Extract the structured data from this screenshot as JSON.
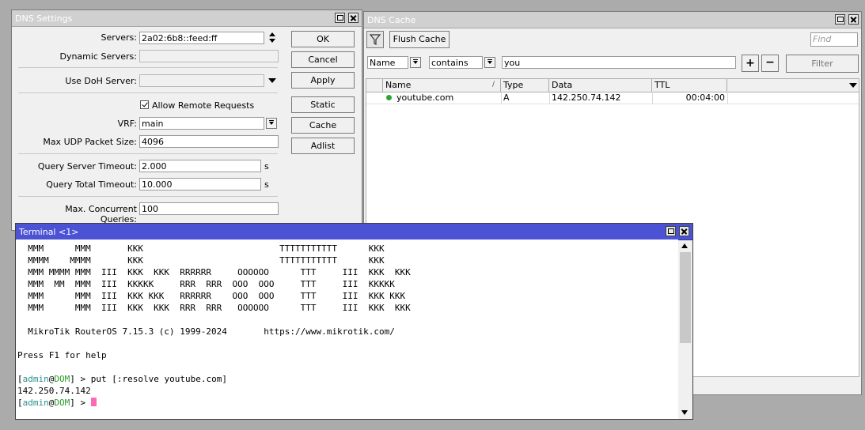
{
  "dns_settings": {
    "title": "DNS Settings",
    "fields": {
      "servers": {
        "label": "Servers:",
        "value": "2a02:6b8::feed:ff"
      },
      "dynamic_servers": {
        "label": "Dynamic Servers:",
        "value": ""
      },
      "use_doh_server": {
        "label": "Use DoH Server:",
        "value": ""
      },
      "allow_remote_requests": {
        "label": "Allow Remote Requests",
        "checked": true
      },
      "vrf": {
        "label": "VRF:",
        "value": "main"
      },
      "max_udp_packet_size": {
        "label": "Max UDP Packet Size:",
        "value": "4096"
      },
      "query_server_timeout": {
        "label": "Query Server Timeout:",
        "value": "2.000",
        "unit": "s"
      },
      "query_total_timeout": {
        "label": "Query Total Timeout:",
        "value": "10.000",
        "unit": "s"
      },
      "max_concurrent_queries": {
        "label": "Max. Concurrent Queries:",
        "value": "100"
      }
    },
    "buttons": {
      "ok": "OK",
      "cancel": "Cancel",
      "apply": "Apply",
      "static": "Static",
      "cache": "Cache",
      "adlist": "Adlist"
    }
  },
  "dns_cache": {
    "title": "DNS Cache",
    "toolbar": {
      "flush": "Flush Cache",
      "find_placeholder": "Find"
    },
    "filter": {
      "field": "Name",
      "operator": "contains",
      "value": "you",
      "filter_button": "Filter"
    },
    "columns": [
      "Name",
      "Type",
      "Data",
      "TTL"
    ],
    "rows": [
      {
        "name": "youtube.com",
        "type": "A",
        "data": "142.250.74.142",
        "ttl": "00:04:00",
        "status_color": "#2fa62f"
      }
    ]
  },
  "terminal": {
    "title": "Terminal <1>",
    "banner": [
      "  MMM      MMM       KKK                          TTTTTTTTTTT      KKK",
      "  MMMM    MMMM       KKK                          TTTTTTTTTTT      KKK",
      "  MMM MMMM MMM  III  KKK  KKK  RRRRRR     OOOOOO      TTT     III  KKK  KKK",
      "  MMM  MM  MMM  III  KKKKK     RRR  RRR  OOO  OOO     TTT     III  KKKKK",
      "  MMM      MMM  III  KKK KKK   RRRRRR    OOO  OOO     TTT     III  KKK KKK",
      "  MMM      MMM  III  KKK  KKK  RRR  RRR   OOOOOO      TTT     III  KKK  KKK"
    ],
    "version_line": "  MikroTik RouterOS 7.15.3 (c) 1999-2024       https://www.mikrotik.com/",
    "help_line": "Press F1 for help",
    "prompt": {
      "user": "admin",
      "at": "@",
      "host": "DOM",
      "suffix": " > "
    },
    "command": "put [:resolve youtube.com]",
    "output": "142.250.74.142"
  },
  "colors": {
    "prompt_user": "#2c8f8f",
    "prompt_host": "#2a9a2a",
    "cursor": "#ff69b4"
  }
}
